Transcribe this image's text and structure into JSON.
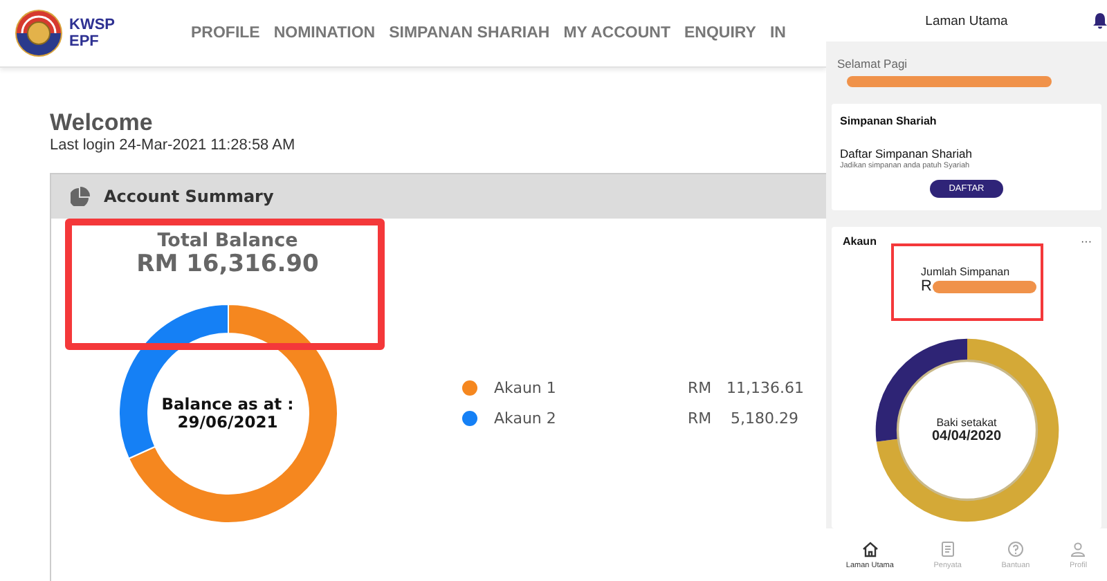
{
  "header": {
    "logo": {
      "line_1": "KWSP",
      "line_2": "EPF"
    },
    "nav": [
      "PROFILE",
      "NOMINATION",
      "SIMPANAN SHARIAH",
      "MY ACCOUNT",
      "ENQUIRY",
      "IN"
    ]
  },
  "welcome": {
    "title": "Welcome",
    "last_login": "Last login 24-Mar-2021 11:28:58 AM"
  },
  "account_summary": {
    "title": "Account Summary",
    "total_label": "Total Balance",
    "total": "RM 16,316.90",
    "center_label": "Balance as at :",
    "center_date": "29/06/2021",
    "chart_data": {
      "type": "donut",
      "categories": [
        "Akaun 1",
        "Akaun 2"
      ],
      "series": [
        {
          "values": [
            68.25,
            31.75
          ]
        }
      ]
    },
    "legend": [
      {
        "currency": "RM",
        "amount": "11,136.61",
        "color": "#f5871f"
      },
      {
        "currency": "RM",
        "amount": "5,180.29",
        "color": "#1580f5"
      }
    ]
  },
  "phone": {
    "title": "Laman Utama",
    "greeting": "Selamat Pagi",
    "shariah_card": {
      "title": "Simpanan Shariah",
      "heading": "Daftar Simpanan Shariah",
      "subtitle": "Jadikan simpanan anda patuh Syariah",
      "button": "DAFTAR"
    },
    "account_card": {
      "title": "Akaun",
      "menu": "···",
      "total_label": "Jumlah Simpanan",
      "total_visible": "R",
      "center_label": "Baki setakat",
      "center_date": "04/04/2020"
    },
    "bottom_nav": [
      {
        "label": "Laman Utama",
        "kind": "home",
        "selected": true
      },
      {
        "label": "Penyata",
        "kind": "document",
        "selected": false
      },
      {
        "label": "Bantuan",
        "kind": "help",
        "selected": false
      },
      {
        "label": "Profil",
        "kind": "person",
        "selected": false
      }
    ]
  }
}
